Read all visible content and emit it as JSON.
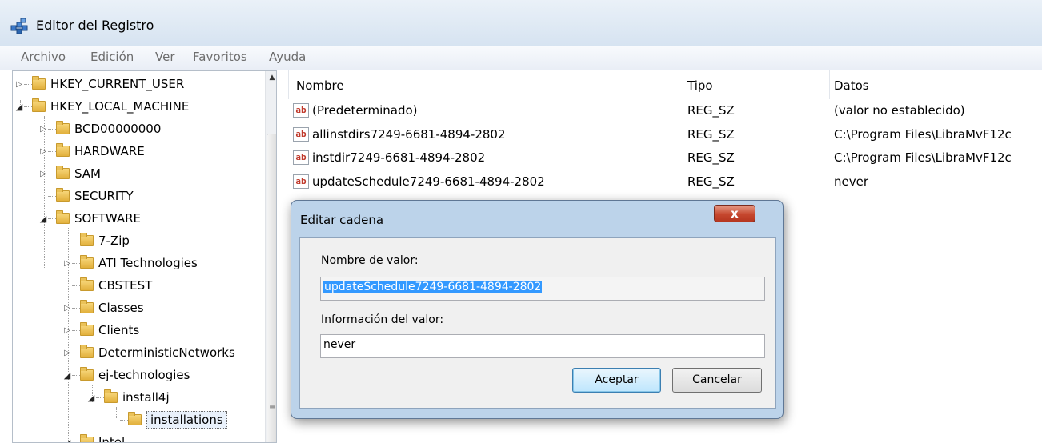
{
  "window": {
    "title": "Editor del Registro"
  },
  "menu": [
    "Archivo",
    "Edición",
    "Ver",
    "Favoritos",
    "Ayuda"
  ],
  "tree": {
    "items": [
      {
        "label": "HKEY_CURRENT_USER",
        "level": 0,
        "expander": "collapsed"
      },
      {
        "label": "HKEY_LOCAL_MACHINE",
        "level": 0,
        "expander": "expanded"
      },
      {
        "label": "BCD00000000",
        "level": 1,
        "expander": "collapsed"
      },
      {
        "label": "HARDWARE",
        "level": 1,
        "expander": "collapsed"
      },
      {
        "label": "SAM",
        "level": 1,
        "expander": "collapsed"
      },
      {
        "label": "SECURITY",
        "level": 1,
        "expander": "none"
      },
      {
        "label": "SOFTWARE",
        "level": 1,
        "expander": "expanded"
      },
      {
        "label": "7-Zip",
        "level": 2,
        "expander": "none"
      },
      {
        "label": "ATI Technologies",
        "level": 2,
        "expander": "collapsed"
      },
      {
        "label": "CBSTEST",
        "level": 2,
        "expander": "none"
      },
      {
        "label": "Classes",
        "level": 2,
        "expander": "collapsed"
      },
      {
        "label": "Clients",
        "level": 2,
        "expander": "collapsed"
      },
      {
        "label": "DeterministicNetworks",
        "level": 2,
        "expander": "collapsed"
      },
      {
        "label": "ej-technologies",
        "level": 2,
        "expander": "expanded"
      },
      {
        "label": "install4j",
        "level": 3,
        "expander": "expanded"
      },
      {
        "label": "installations",
        "level": 4,
        "expander": "none",
        "selected": true
      },
      {
        "label": "Intel",
        "level": 2,
        "expander": "expanded"
      }
    ]
  },
  "list": {
    "columns": {
      "name": "Nombre",
      "type": "Tipo",
      "data": "Datos"
    },
    "rows": [
      {
        "name": "(Predeterminado)",
        "type": "REG_SZ",
        "data": "(valor no establecido)"
      },
      {
        "name": "allinstdirs7249-6681-4894-2802",
        "type": "REG_SZ",
        "data": "C:\\Program Files\\LibraMvF12c"
      },
      {
        "name": "instdir7249-6681-4894-2802",
        "type": "REG_SZ",
        "data": "C:\\Program Files\\LibraMvF12c"
      },
      {
        "name": "updateSchedule7249-6681-4894-2802",
        "type": "REG_SZ",
        "data": "never"
      }
    ],
    "icon": "ab"
  },
  "dialog": {
    "title": "Editar cadena",
    "close_glyph": "x",
    "value_name_label": "Nombre de valor:",
    "value_name": "updateSchedule7249-6681-4894-2802",
    "value_data_label": "Información del valor:",
    "value_data": "never",
    "ok_label": "Aceptar",
    "cancel_label": "Cancelar"
  }
}
